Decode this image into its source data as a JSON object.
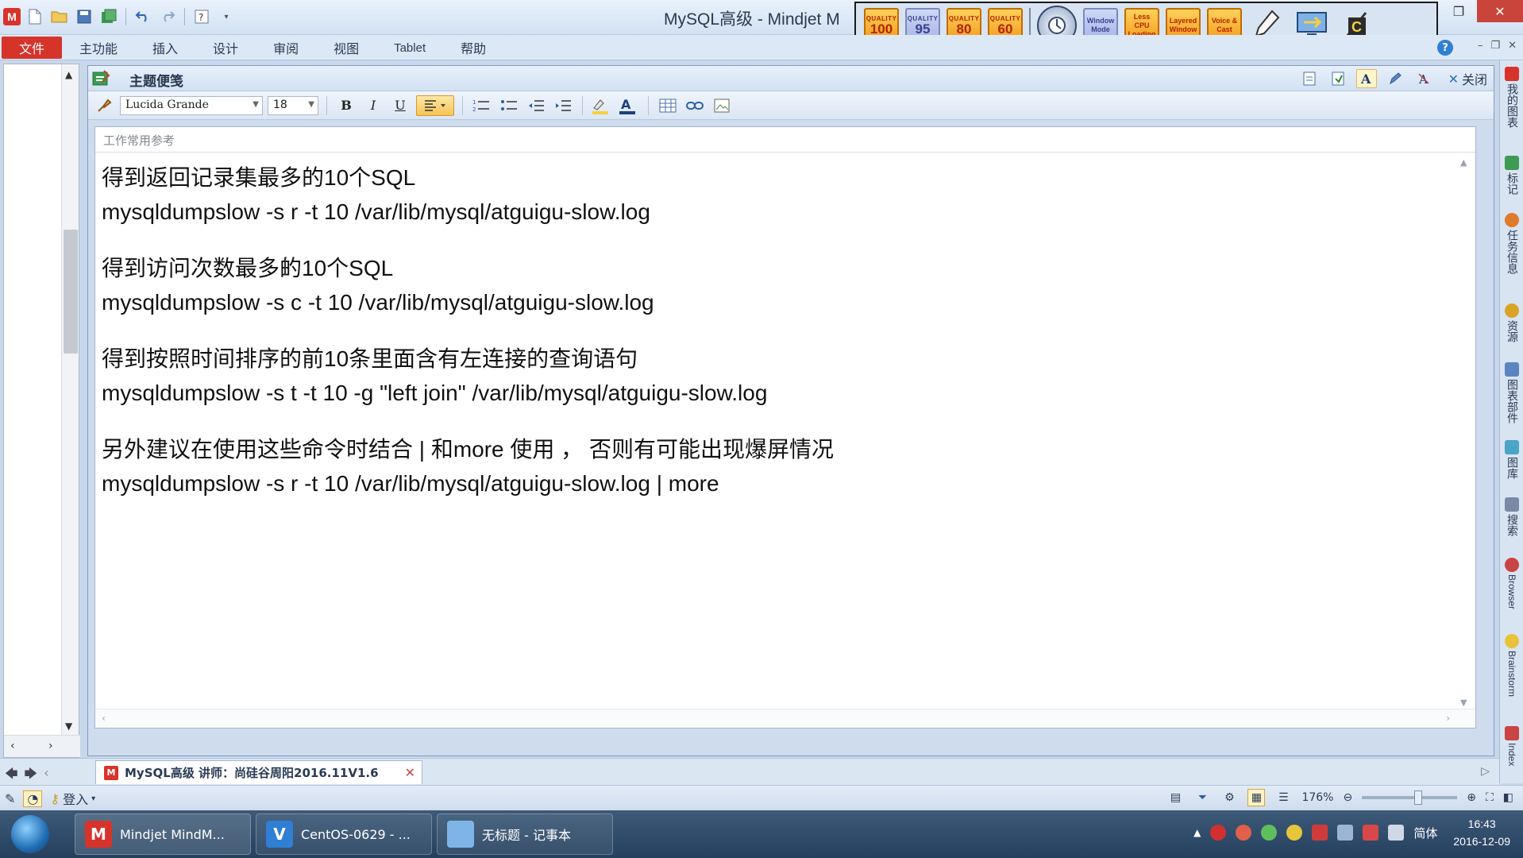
{
  "window": {
    "title": "MySQL高级 - Mindjet M"
  },
  "overlay": {
    "buttons": [
      {
        "top": "QUALITY",
        "value": "100"
      },
      {
        "top": "QUALITY",
        "value": "95"
      },
      {
        "top": "QUALITY",
        "value": "80"
      },
      {
        "top": "QUALITY",
        "value": "60"
      }
    ],
    "modes": [
      "Window Mode",
      "Less CPU Loading",
      "Layered Window",
      "Voice & Cast"
    ]
  },
  "menu": {
    "file": "文件",
    "items": [
      "主功能",
      "插入",
      "设计",
      "审阅",
      "视图",
      "Tablet",
      "帮助"
    ]
  },
  "notes_panel": {
    "title": "主题便笺",
    "close_label": "关闭",
    "font_family": "Lucida Grande",
    "font_size": "18",
    "subject": "工作常用参考",
    "lines": {
      "l1": "得到返回记录集最多的10个SQL",
      "l2": "mysqldumpslow -s r -t 10 /var/lib/mysql/atguigu-slow.log",
      "l3": "得到访问次数最多的10个SQL",
      "l4": "mysqldumpslow -s c -t 10 /var/lib/mysql/atguigu-slow.log",
      "l5": "得到按照时间排序的前10条里面含有左连接的查询语句",
      "l6": "mysqldumpslow -s t -t 10 -g \"left join\" /var/lib/mysql/atguigu-slow.log",
      "l7": "另外建议在使用这些命令时结合 | 和more 使用 ， 否则有可能出现爆屏情况",
      "l8": "mysqldumpslow -s r -t 10 /var/lib/mysql/atguigu-slow.log | more"
    }
  },
  "sidebar": {
    "tabs": [
      "我的图表",
      "标记",
      "任务信息",
      "资源",
      "图表部件",
      "图库",
      "搜索",
      "Browser",
      "Brainstorm",
      "Index"
    ]
  },
  "doc_tab": {
    "label": "MySQL高级 讲师：尚硅谷周阳2016.11V1.6"
  },
  "status": {
    "login": "登入",
    "zoom": "176%",
    "zoom_fraction": 0.6
  },
  "taskbar": {
    "tasks": [
      "Mindjet MindM...",
      "CentOS-0629 - ...",
      "无标题 - 记事本"
    ],
    "lang": "简体",
    "time": "16:43",
    "date": "2016-12-09"
  }
}
